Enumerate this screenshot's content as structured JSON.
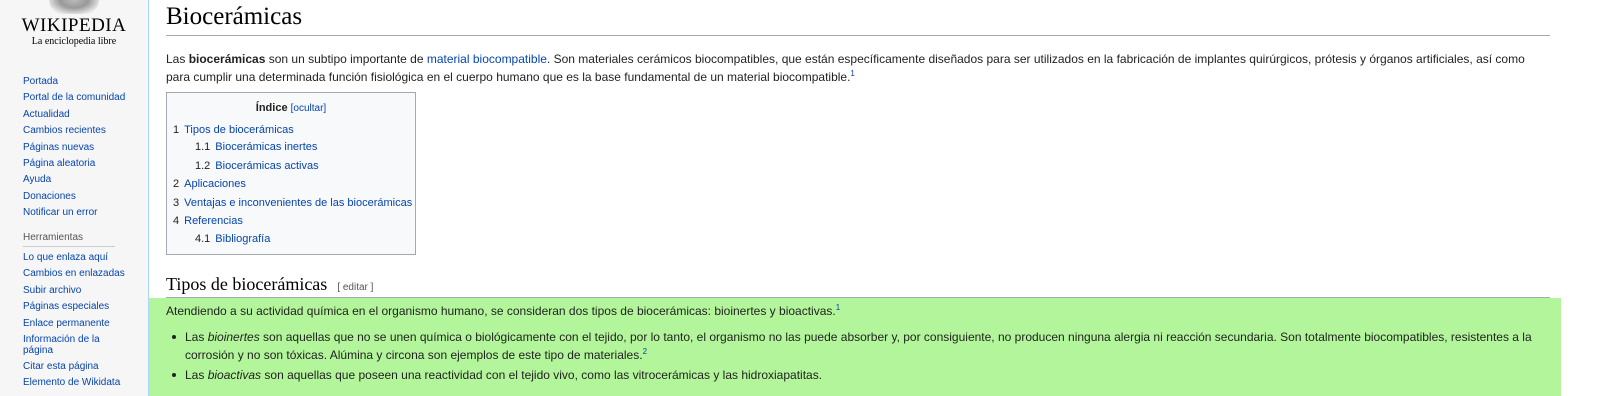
{
  "logo": {
    "wordmark": "WIKIPEDIA",
    "tagline": "La enciclopedia libre"
  },
  "nav_main": [
    "Portada",
    "Portal de la comunidad",
    "Actualidad",
    "Cambios recientes",
    "Páginas nuevas",
    "Página aleatoria",
    "Ayuda",
    "Donaciones",
    "Notificar un error"
  ],
  "tools": {
    "heading": "Herramientas",
    "items": [
      "Lo que enlaza aquí",
      "Cambios en enlazadas",
      "Subir archivo",
      "Páginas especiales",
      "Enlace permanente",
      "Información de la página",
      "Citar esta página",
      "Elemento de Wikidata"
    ]
  },
  "article": {
    "title": "Biocerámicas",
    "intro": {
      "p1": "Las ",
      "bold": "biocerámicas",
      "p2": " son un subtipo importante de ",
      "link1": "material",
      "link2": "biocompatible",
      "p3": ". Son materiales cerámicos biocompatibles, que están específicamente diseñados para ser utilizados en la fabricación de implantes quirúrgicos, prótesis y órganos artificiales, así como para cumplir una determinada función fisiológica en el cuerpo humano que es la base fundamental de un material biocompatible.",
      "ref": "1"
    },
    "toc": {
      "title": "Índice",
      "toggle": "[ocultar]",
      "items": [
        {
          "num": "1",
          "text": "Tipos de biocerámicas"
        },
        {
          "num": "1.1",
          "text": "Biocerámicas inertes"
        },
        {
          "num": "1.2",
          "text": "Biocerámicas activas"
        },
        {
          "num": "2",
          "text": "Aplicaciones"
        },
        {
          "num": "3",
          "text": "Ventajas e inconvenientes de las biocerámicas"
        },
        {
          "num": "4",
          "text": "Referencias"
        },
        {
          "num": "4.1",
          "text": "Bibliografía"
        }
      ]
    },
    "section": {
      "heading": "Tipos de biocerámicas",
      "edit": "[ editar ]",
      "para": "Atendiendo a su actividad química en el organismo humano, se consideran dos tipos de biocerámicas: bioinertes y bioactivas.",
      "para_ref": "1",
      "bullets": [
        {
          "pre": "Las ",
          "em": "bioinertes",
          "post": " son aquellas que no se unen química o biológicamente con el tejido, por lo tanto, el organismo no las puede absorber y, por consiguiente, no producen ninguna alergia ni reacción secundaria. Son totalmente biocompatibles, resistentes a la corrosión y no son tóxicas. Alúmina y circona son ejemplos de este tipo de materiales.",
          "ref": "2"
        },
        {
          "pre": "Las ",
          "em": "bioactivas",
          "post": " son aquellas que poseen una reactividad con el tejido vivo, como las vitrocerámicas y las hidroxiapatitas.",
          "ref": ""
        }
      ]
    }
  },
  "colors": {
    "link": "#0645ad",
    "highlight": "#b3f59a",
    "border": "#a7d7f9"
  }
}
